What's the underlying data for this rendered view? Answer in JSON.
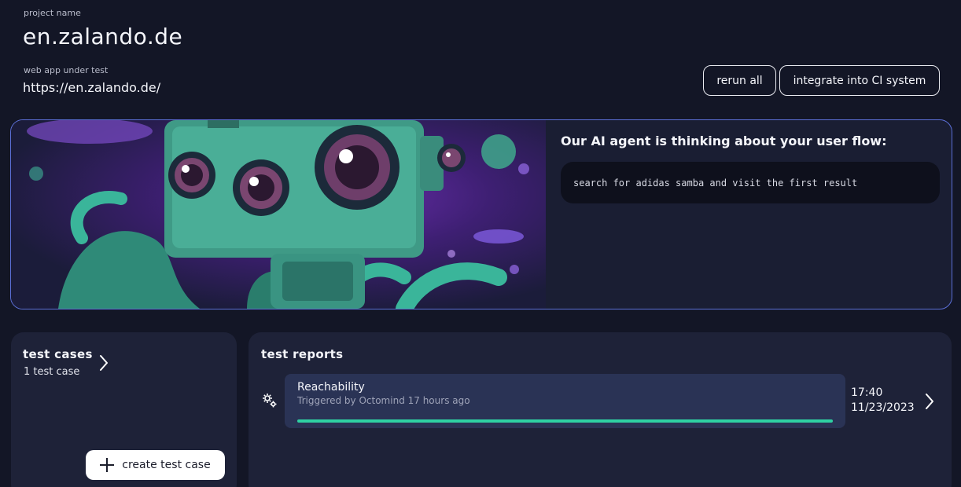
{
  "header": {
    "project_label": "project name",
    "project_name": "en.zalando.de",
    "webapp_label": "web app under test",
    "webapp_url": "https://en.zalando.de/",
    "rerun_label": "rerun all",
    "integrate_label": "integrate into CI system"
  },
  "hero": {
    "title": "Our AI agent is thinking about your user flow:",
    "prompt": "search for adidas samba and visit the first result",
    "illustration": "robot-octopus-illustration"
  },
  "test_cases": {
    "title": "test cases",
    "count": "1 test case",
    "create_label": "create test case"
  },
  "test_reports": {
    "title": "test reports",
    "items": [
      {
        "name": "Reachability",
        "subtitle": "Triggered by Octomind 17 hours ago",
        "time": "17:40",
        "date": "11/23/2023",
        "progress": 1.0,
        "icon": "gears-icon"
      }
    ]
  },
  "colors": {
    "background": "#131626",
    "card": "#1e2238",
    "report_item": "#2a3355",
    "progress": "#2fd1a3",
    "hero_border": "#5b6fd6"
  }
}
